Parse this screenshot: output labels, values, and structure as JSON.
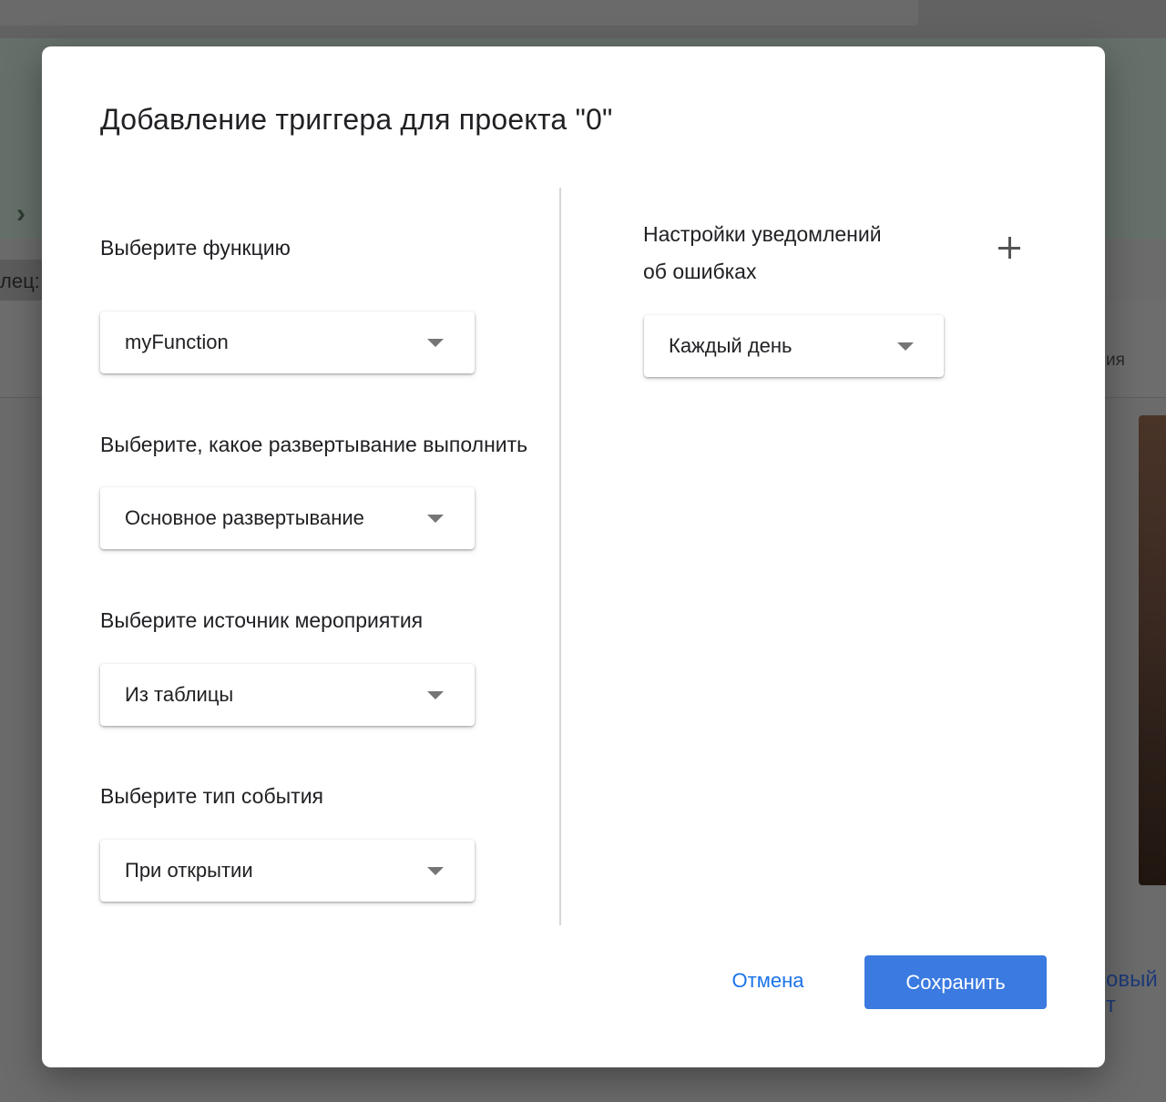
{
  "background": {
    "partial_label_left": "лец:",
    "partial_label_right": "ия",
    "partial_link": "овый т"
  },
  "dialog": {
    "title": "Добавление триггера для проекта \"0\"",
    "function": {
      "label": "Выберите функцию",
      "value": "myFunction"
    },
    "deployment": {
      "label": "Выберите, какое развертывание выполнить",
      "value": "Основное развертывание"
    },
    "event_source": {
      "label": "Выберите источник мероприятия",
      "value": "Из таблицы"
    },
    "event_type": {
      "label": "Выберите тип события",
      "value": "При открытии"
    },
    "notifications": {
      "label_line1": "Настройки уведомлений",
      "label_line2": "об ошибках",
      "value": "Каждый день",
      "add_icon": "plus-icon"
    },
    "buttons": {
      "cancel": "Отмена",
      "save": "Сохранить"
    },
    "colors": {
      "accent": "#1a73e8",
      "save_button": "#3b7ae0"
    }
  }
}
